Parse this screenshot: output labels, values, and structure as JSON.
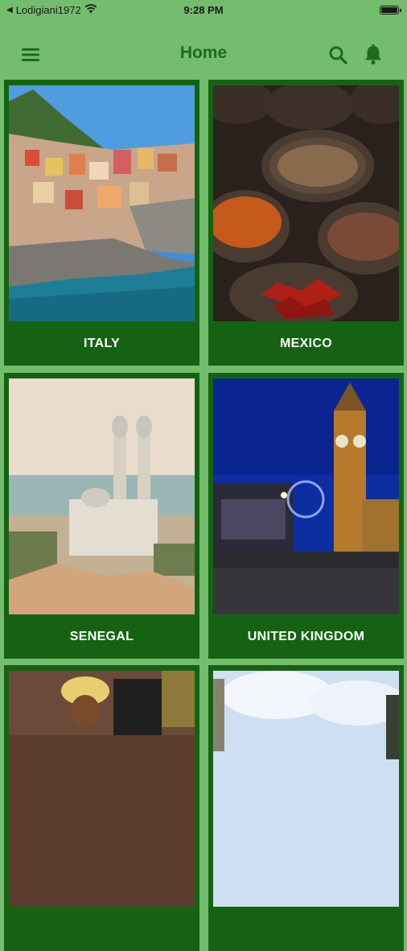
{
  "status_bar": {
    "carrier": "Lodigiani1972",
    "time": "9:28 PM"
  },
  "header": {
    "title": "Home",
    "menu_icon": "hamburger-menu-icon",
    "search_icon": "search-icon",
    "notification_icon": "bell-icon"
  },
  "colors": {
    "background": "#74bd6e",
    "card": "#156312",
    "title": "#1d6b20"
  },
  "countries": [
    {
      "name": "ITALY"
    },
    {
      "name": "MEXICO"
    },
    {
      "name": "SENEGAL"
    },
    {
      "name": "UNITED KINGDOM"
    },
    {
      "name": ""
    },
    {
      "name": ""
    }
  ]
}
